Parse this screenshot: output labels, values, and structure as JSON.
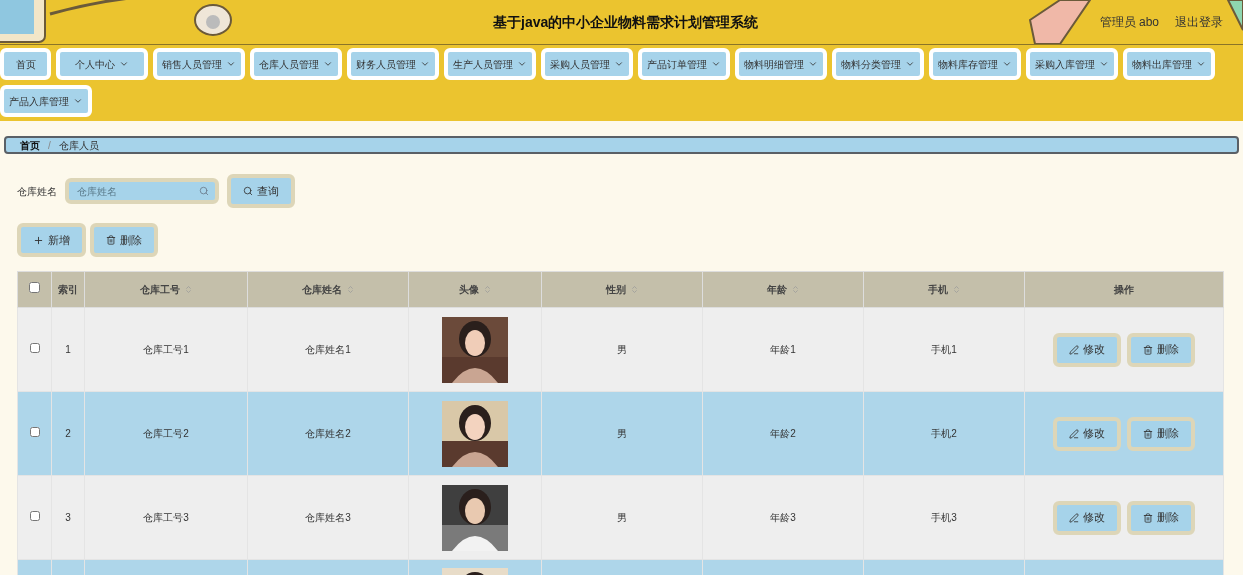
{
  "header": {
    "title": "基于java的中小企业物料需求计划管理系统",
    "user": "管理员 abo",
    "logout": "退出登录"
  },
  "nav": [
    {
      "label": "首页",
      "dropdown": false
    },
    {
      "label": "个人中心",
      "dropdown": true
    },
    {
      "label": "销售人员管理",
      "dropdown": true
    },
    {
      "label": "仓库人员管理",
      "dropdown": true
    },
    {
      "label": "财务人员管理",
      "dropdown": true
    },
    {
      "label": "生产人员管理",
      "dropdown": true
    },
    {
      "label": "采购人员管理",
      "dropdown": true
    },
    {
      "label": "产品订单管理",
      "dropdown": true
    },
    {
      "label": "物料明细管理",
      "dropdown": true
    },
    {
      "label": "物料分类管理",
      "dropdown": true
    },
    {
      "label": "物料库存管理",
      "dropdown": true
    },
    {
      "label": "采购入库管理",
      "dropdown": true
    },
    {
      "label": "物料出库管理",
      "dropdown": true
    },
    {
      "label": "产品入库管理",
      "dropdown": true
    }
  ],
  "breadcrumb": [
    "首页",
    "仓库人员"
  ],
  "breadcrumb_separator": "/",
  "search": {
    "label": "仓库姓名",
    "placeholder": "仓库姓名",
    "button": "查询"
  },
  "actions": [
    "新增",
    "删除"
  ],
  "table": {
    "columns": [
      {
        "label": "索引",
        "sortable": false
      },
      {
        "label": "仓库工号",
        "sortable": true
      },
      {
        "label": "仓库姓名",
        "sortable": true
      },
      {
        "label": "头像",
        "sortable": true
      },
      {
        "label": "性别",
        "sortable": true
      },
      {
        "label": "年龄",
        "sortable": true
      },
      {
        "label": "手机",
        "sortable": true
      },
      {
        "label": "操作",
        "sortable": false
      }
    ],
    "header_checked": false,
    "rows": [
      {
        "checked": false,
        "index": "1",
        "id": "仓库工号1",
        "name": "仓库姓名1",
        "avatar": {
          "kind": "picture"
        },
        "gender": "男",
        "age": "年龄1",
        "phone": "手机1",
        "edit": "修改",
        "delete": "删除"
      },
      {
        "checked": false,
        "index": "2",
        "id": "仓库工号2",
        "name": "仓库姓名2",
        "avatar": {
          "kind": "picture"
        },
        "gender": "男",
        "age": "年龄2",
        "phone": "手机2",
        "edit": "修改",
        "delete": "删除"
      },
      {
        "checked": false,
        "index": "3",
        "id": "仓库工号3",
        "name": "仓库姓名3",
        "avatar": {
          "kind": "picture"
        },
        "gender": "男",
        "age": "年龄3",
        "phone": "手机3",
        "edit": "修改",
        "delete": "删除"
      },
      {
        "avatar": {
          "kind": "picture"
        }
      }
    ]
  }
}
